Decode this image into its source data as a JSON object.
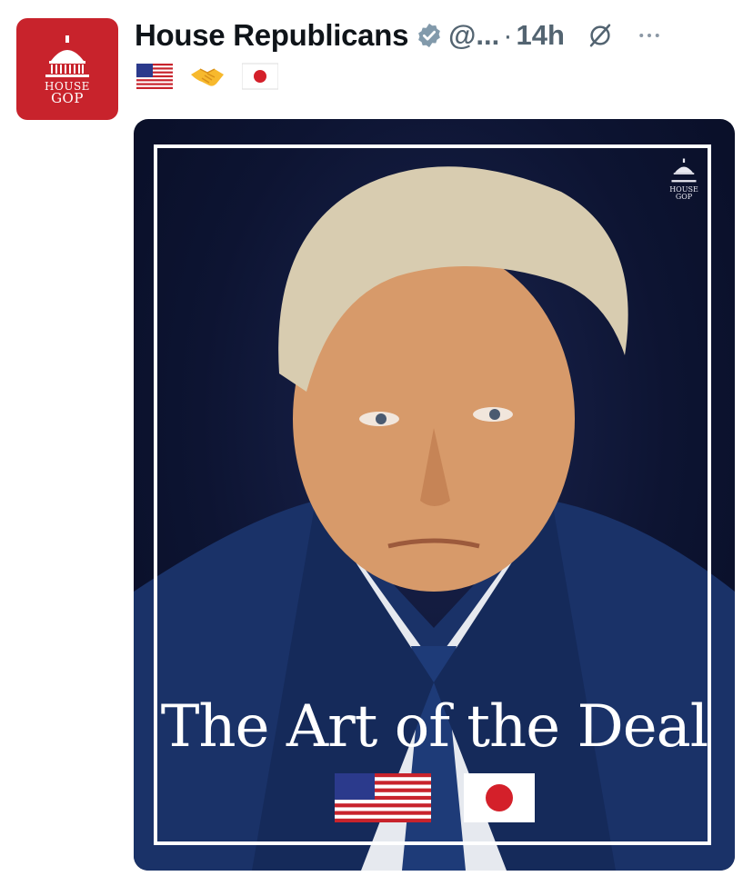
{
  "author": {
    "name": "House Republicans",
    "handle": "@...",
    "separator": "·",
    "time": "14h",
    "avatar_text_line1": "HOUSE",
    "avatar_text_line2": "GOP",
    "verified": true
  },
  "post": {
    "emojis": [
      "us-flag",
      "handshake",
      "japan-flag"
    ]
  },
  "media": {
    "caption": "The Art of the Deal",
    "corner_logo_line1": "HOUSE",
    "corner_logo_line2": "GOP",
    "flags": [
      "us-flag",
      "japan-flag"
    ]
  },
  "colors": {
    "avatar_bg": "#c8232c",
    "media_bg": "#0d1432",
    "verified_badge": "#829aab",
    "secondary_text": "#536471"
  }
}
